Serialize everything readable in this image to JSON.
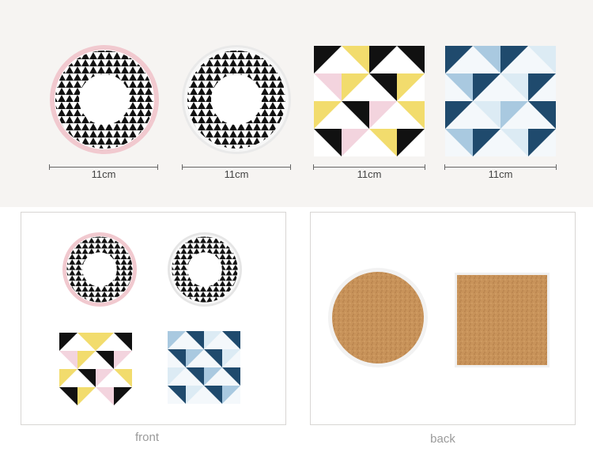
{
  "top_row": {
    "dimensions": [
      {
        "label": "11cm"
      },
      {
        "label": "11cm"
      },
      {
        "label": "11cm"
      },
      {
        "label": "11cm"
      }
    ]
  },
  "captions": {
    "front": "front",
    "back": "back"
  },
  "colors": {
    "pink_rim": "#f1c9cf",
    "white_rim": "#f3f3f3",
    "black": "#111111",
    "yellow": "#f2dc6d",
    "pink": "#f3d4de",
    "navy": "#1f4a6d",
    "light_blue": "#a9c9e0",
    "pale_blue": "#dcebf4",
    "cork": "#c8935a"
  }
}
